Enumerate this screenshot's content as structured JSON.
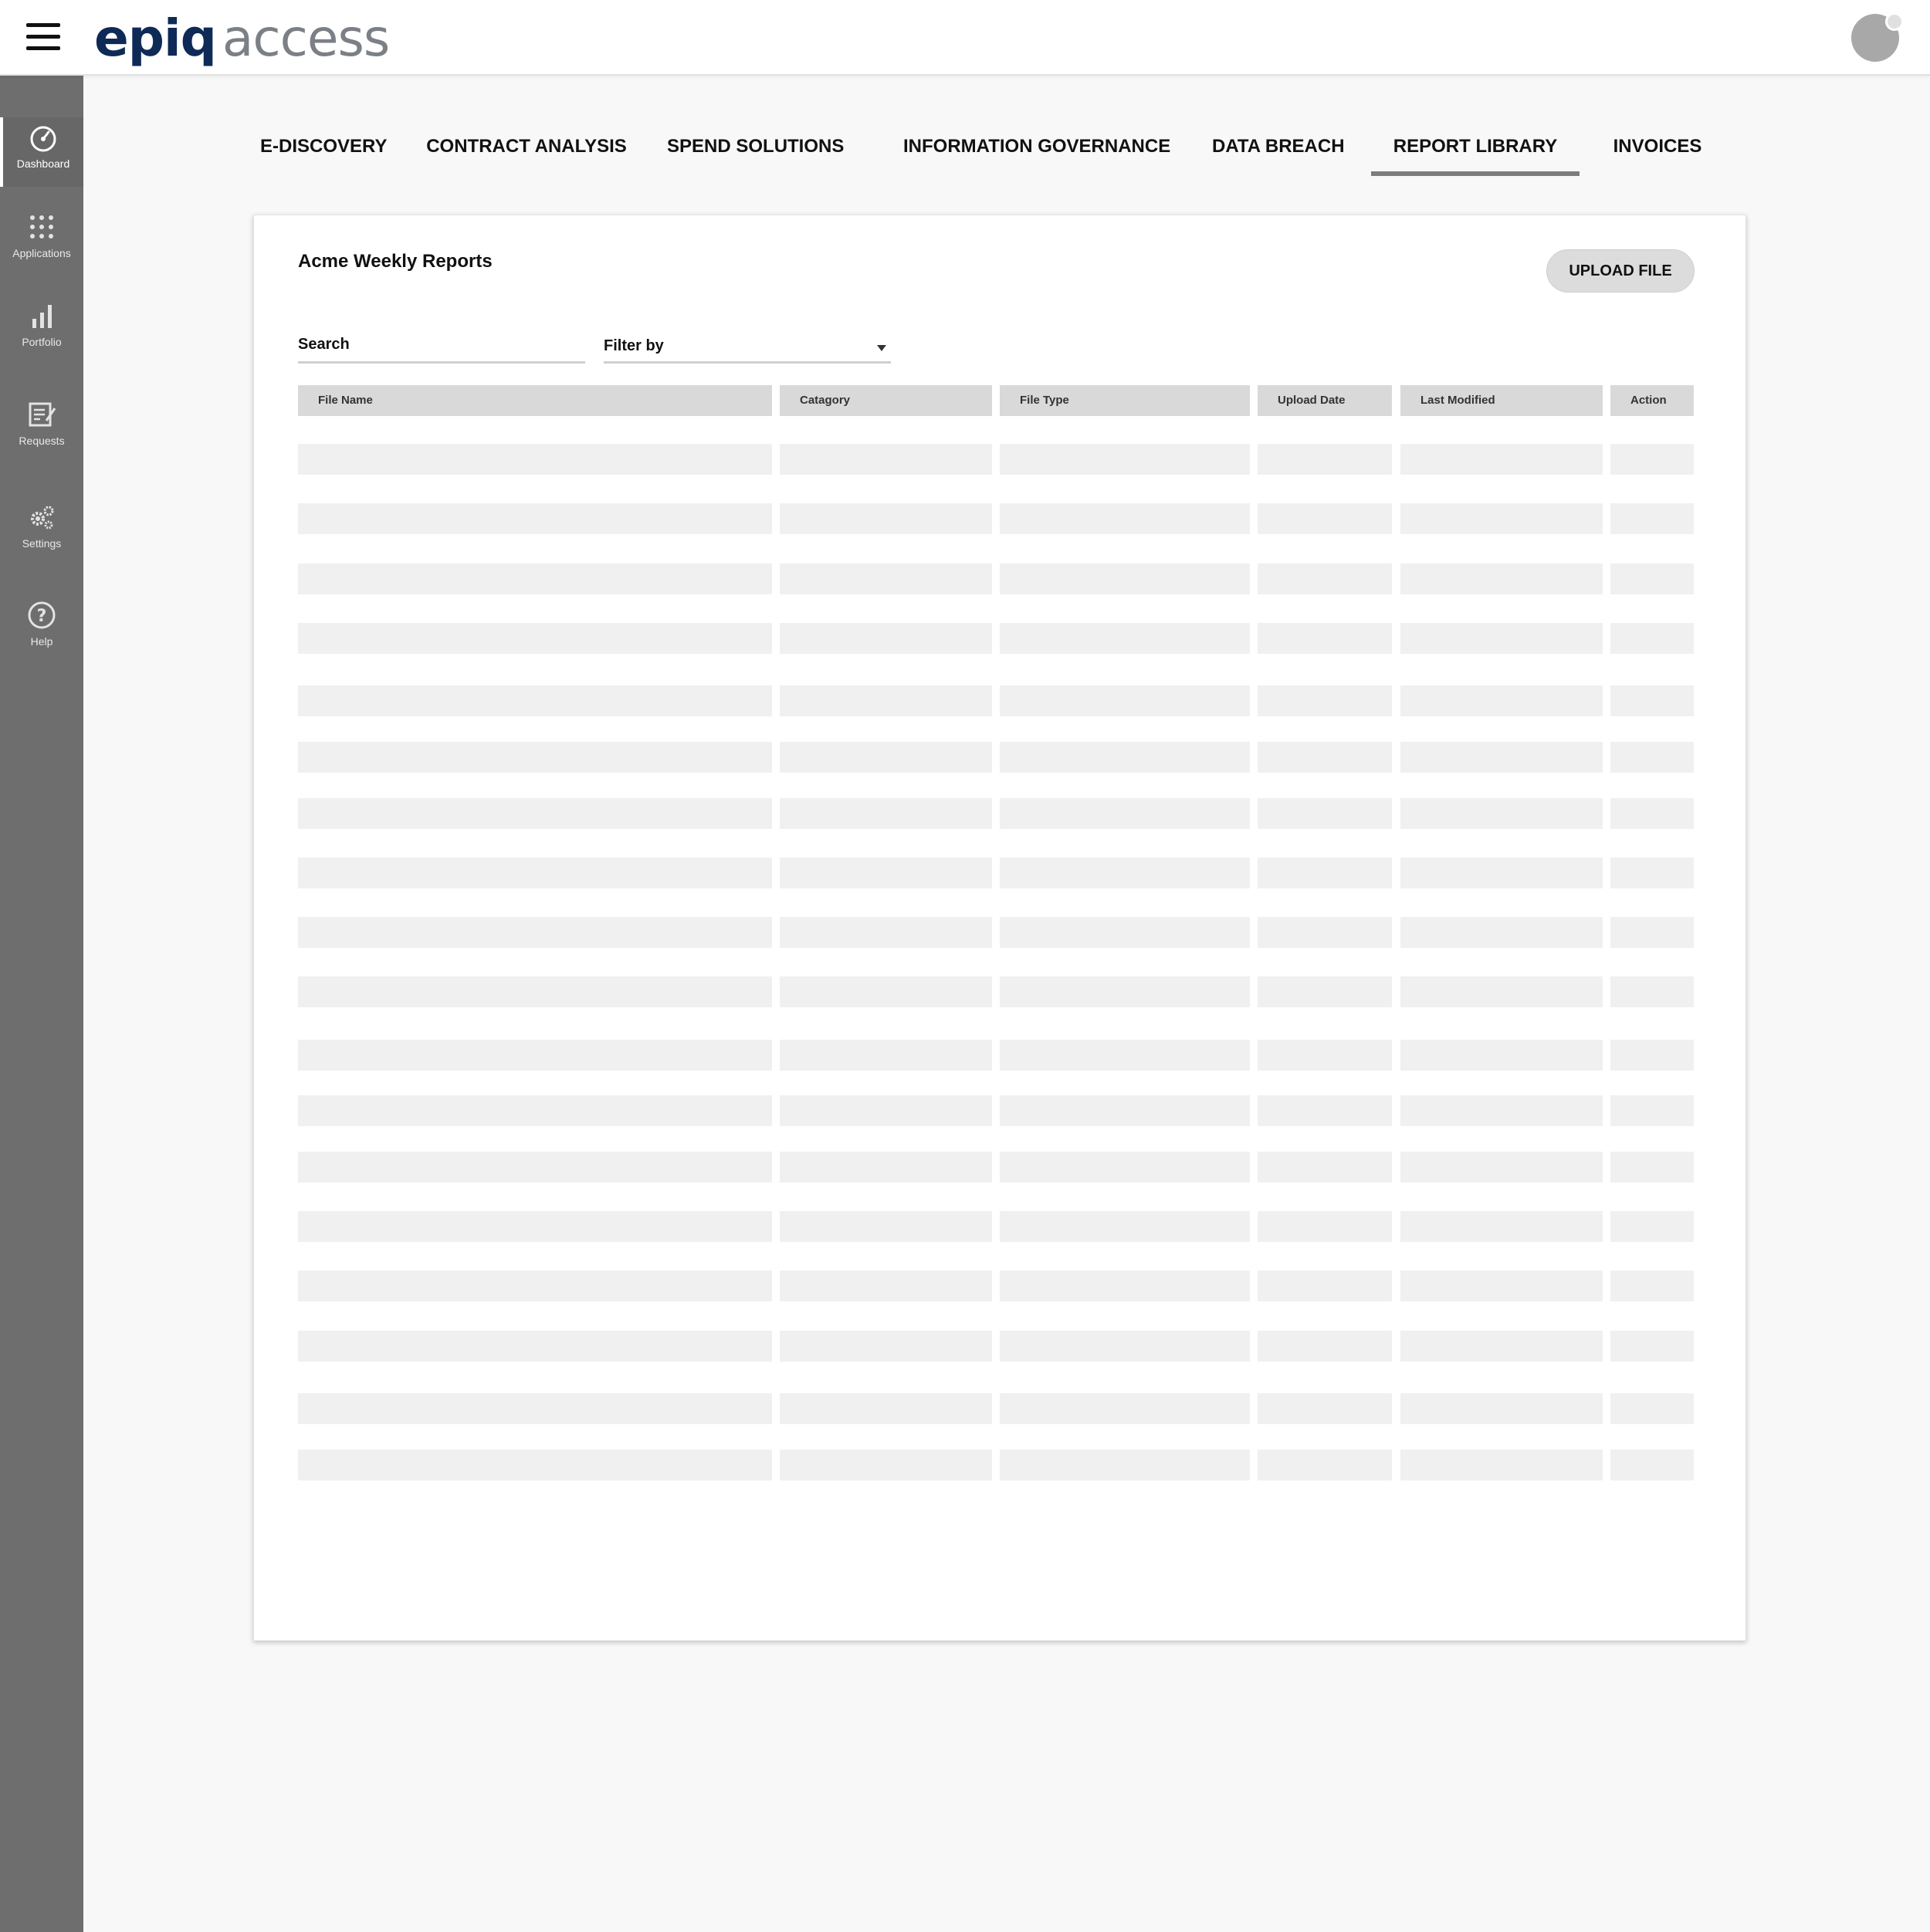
{
  "header": {
    "logo_epiq": "epiq",
    "logo_access": "access",
    "menu_icon": "hamburger-menu-icon",
    "avatar_icon": "user-avatar-icon"
  },
  "sidebar": {
    "items": [
      {
        "label": "Dashboard",
        "icon": "dashboard-gauge-icon",
        "active": true
      },
      {
        "label": "Applications",
        "icon": "apps-grid-icon",
        "active": false
      },
      {
        "label": "Portfolio",
        "icon": "bar-chart-icon",
        "active": false
      },
      {
        "label": "Requests",
        "icon": "request-form-icon",
        "active": false
      },
      {
        "label": "Settings",
        "icon": "gears-icon",
        "active": false
      },
      {
        "label": "Help",
        "icon": "help-question-icon",
        "active": false
      }
    ]
  },
  "tabs": [
    {
      "label": "E-DISCOVERY",
      "active": false
    },
    {
      "label": "CONTRACT ANALYSIS",
      "active": false
    },
    {
      "label": "SPEND SOLUTIONS",
      "active": false
    },
    {
      "label": "INFORMATION GOVERNANCE",
      "active": false
    },
    {
      "label": "DATA BREACH",
      "active": false
    },
    {
      "label": "REPORT LIBRARY",
      "active": true
    },
    {
      "label": "INVOICES",
      "active": false
    }
  ],
  "card": {
    "title": "Acme Weekly Reports",
    "upload_label": "UPLOAD FILE",
    "search_placeholder": "Search",
    "filter_label": "Filter by"
  },
  "table": {
    "columns": [
      "File Name",
      "Catagory",
      "File Type",
      "Upload Date",
      "Last Modified",
      "Action"
    ],
    "rows": [
      [],
      [],
      [],
      [],
      [],
      [],
      [],
      [],
      [],
      [],
      [],
      [],
      [],
      [],
      [],
      [],
      [],
      []
    ]
  },
  "colors": {
    "sidebar_bg": "#6e6e6e",
    "header_cell_bg": "#d9d9d9",
    "row_placeholder_bg": "#f0f0f0",
    "logo_navy": "#0e2a57",
    "logo_gray": "#7b7f86"
  }
}
